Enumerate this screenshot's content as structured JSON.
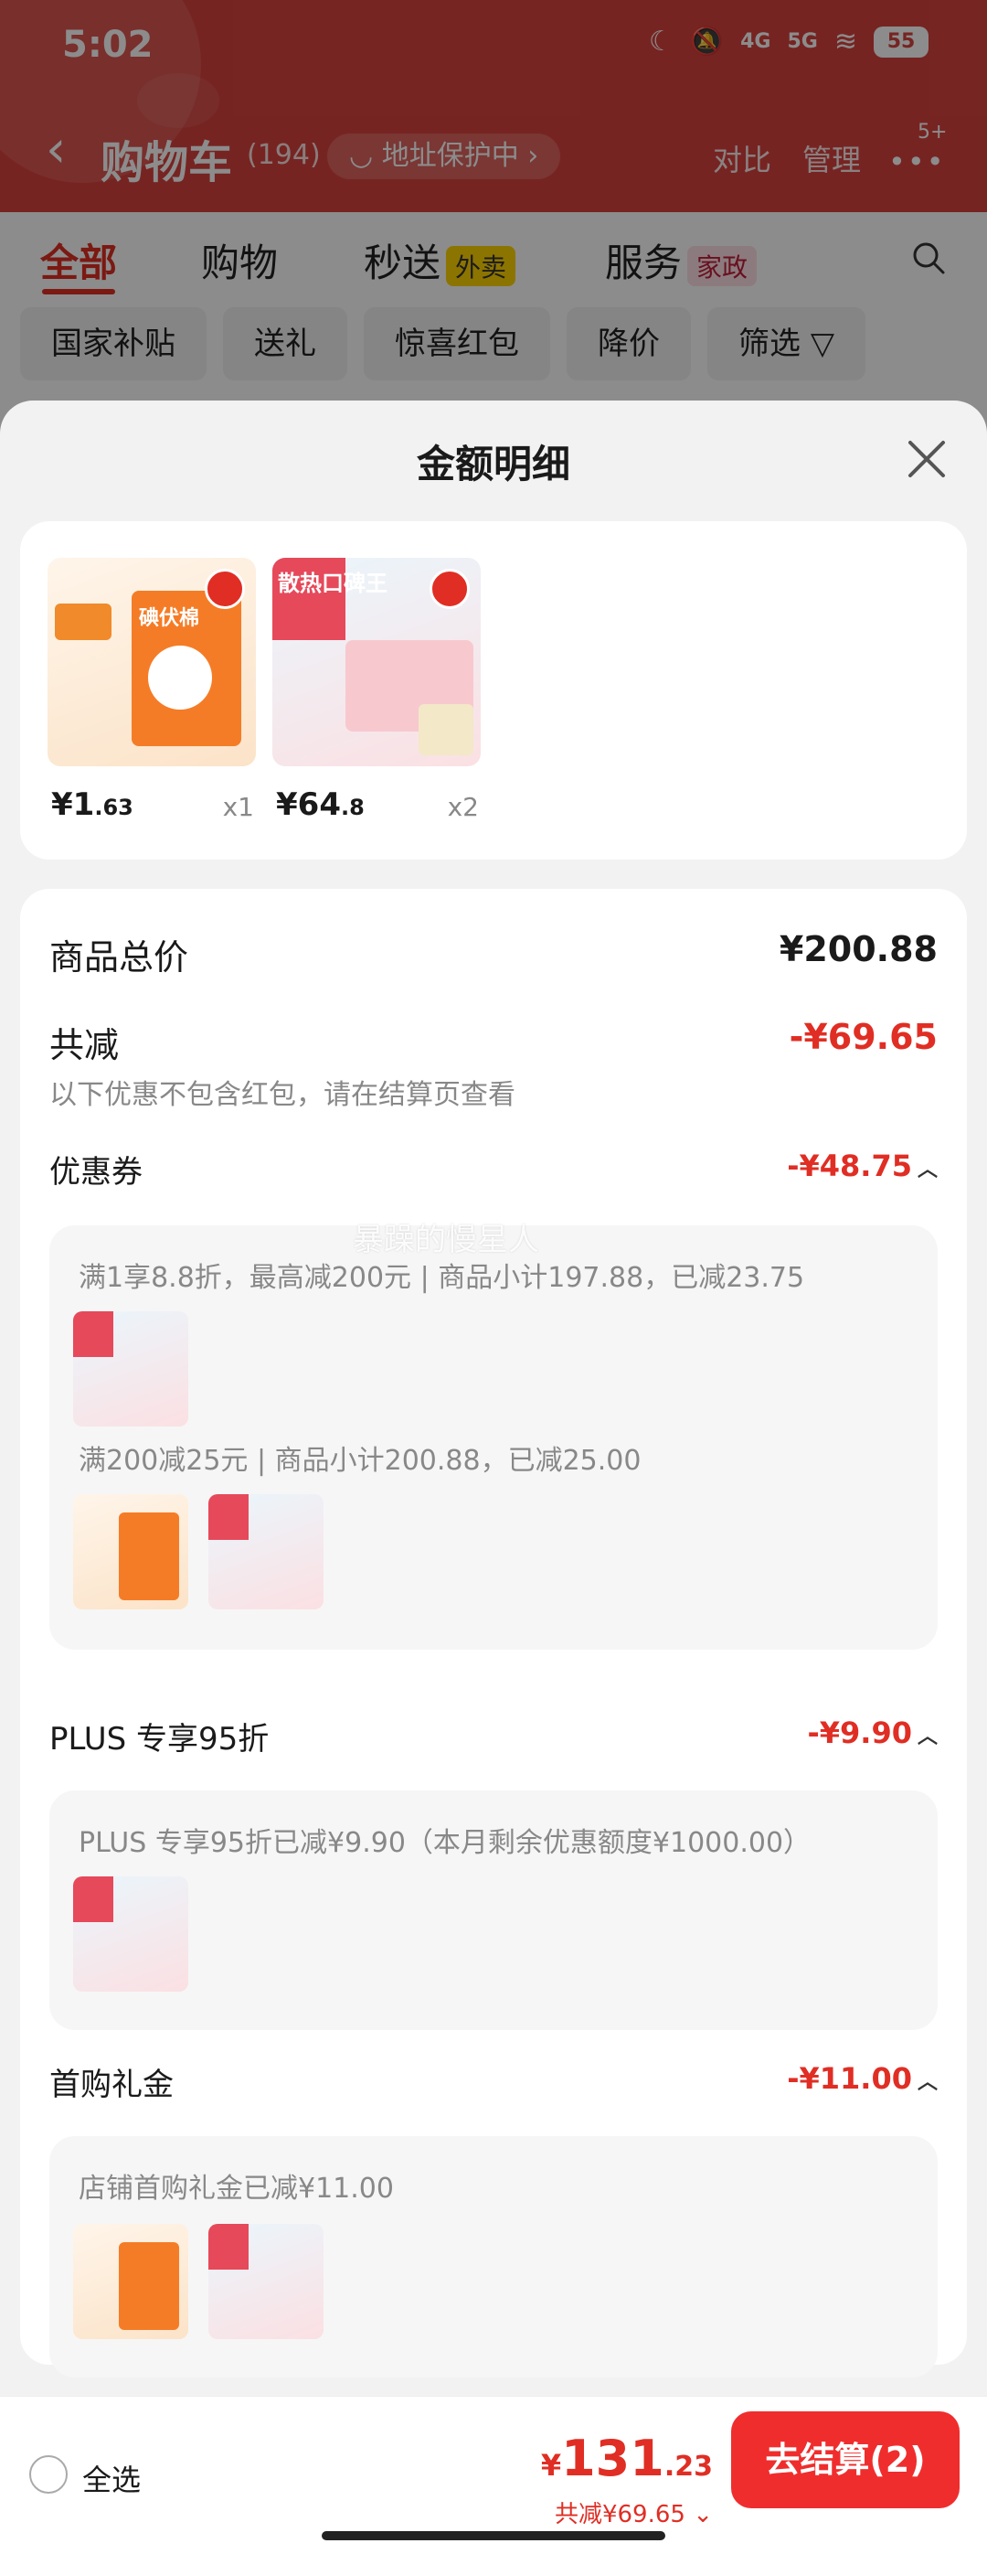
{
  "status_bar": {
    "time": "5:02",
    "network_4g": "4G",
    "network_5g": "5G",
    "battery": "55"
  },
  "header": {
    "back_glyph": "‹",
    "title": "购物车",
    "count": "(194)",
    "address_protect": "地址保护中",
    "compare": "对比",
    "manage": "管理",
    "more_badge": "5+"
  },
  "tabs": [
    {
      "label": "全部"
    },
    {
      "label": "购物"
    },
    {
      "label": "秒送",
      "tag": "外卖"
    },
    {
      "label": "服务",
      "tag": "家政"
    }
  ],
  "filters": [
    "国家补贴",
    "送礼",
    "惊喜红包",
    "降价",
    "筛选"
  ],
  "sheet": {
    "title": "金额明细",
    "products": [
      {
        "price_symbol": "¥",
        "price_int": "1",
        "price_dec": ".63",
        "qty": "x1",
        "thumb_text": "碘伏棉"
      },
      {
        "price_symbol": "¥",
        "price_int": "64",
        "price_dec": ".8",
        "qty": "x2",
        "thumb_text": "散热口碑王"
      }
    ],
    "total_label": "商品总价",
    "total_value": "¥200.88",
    "reduce_label": "共减",
    "reduce_value": "-¥69.65",
    "note": "以下优惠不包含红包，请在结算页查看",
    "coupon": {
      "label": "优惠券",
      "value": "-¥48.75",
      "rules": [
        "满1享8.8折，最高减200元 | 商品小计197.88，已减23.75",
        "满200减25元 | 商品小计200.88，已减25.00"
      ]
    },
    "plus": {
      "label": "PLUS 专享95折",
      "value": "-¥9.90",
      "rule": "PLUS 专享95折已减¥9.90（本月剩余优惠额度¥1000.00）"
    },
    "first": {
      "label": "首购礼金",
      "value": "-¥11.00",
      "rule": "店铺首购礼金已减¥11.00"
    }
  },
  "watermark": "暴躁的慢星人",
  "bottom_bar": {
    "select_all": "全选",
    "currency": "¥",
    "total_int": "131",
    "total_dec": ".23",
    "reduce_text": "共减¥69.65",
    "checkout": "去结算(2)"
  },
  "colors": {
    "brand_red": "#e02e24",
    "header_red": "#d8433e",
    "checkout_red": "#f02d2d"
  }
}
